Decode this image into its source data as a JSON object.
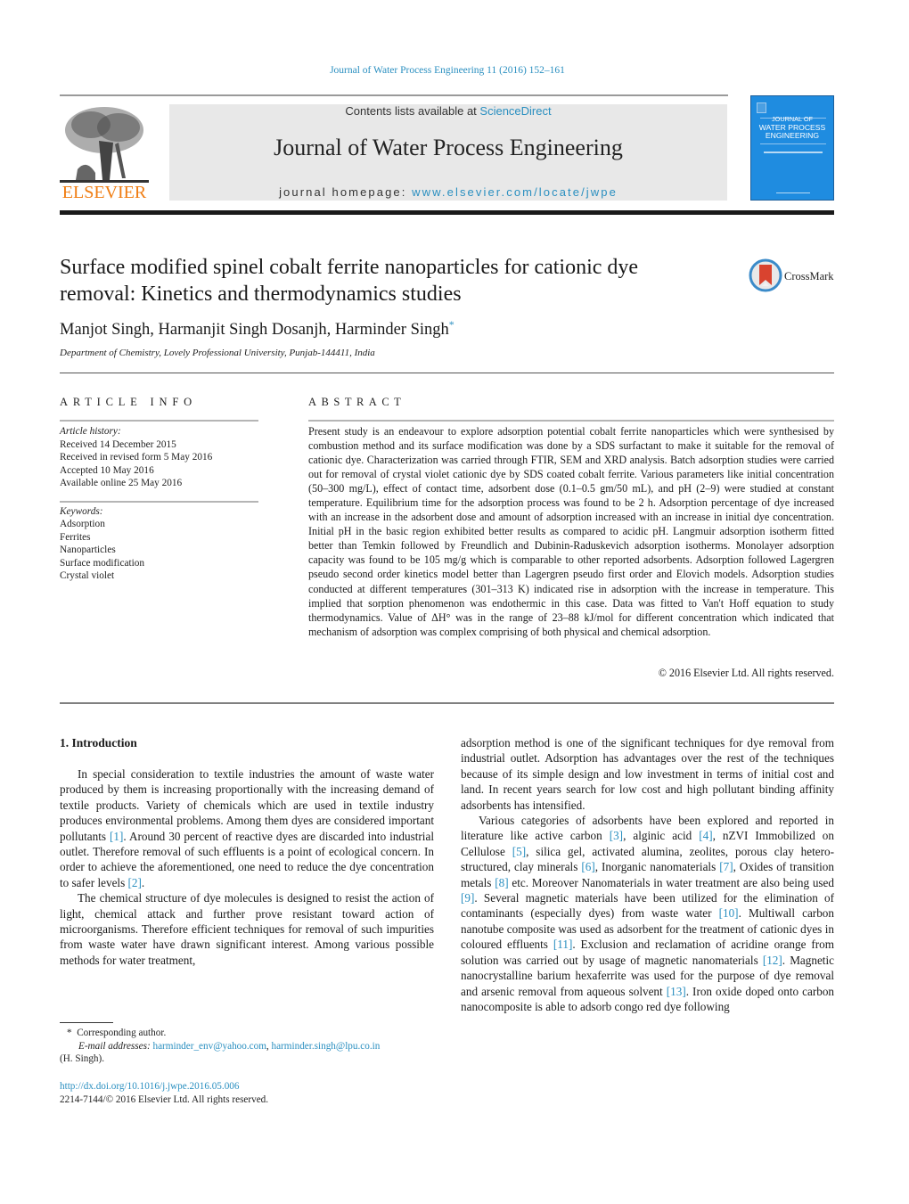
{
  "running_head": "Journal of Water Process Engineering 11 (2016) 152–161",
  "logo": {
    "icon": "elsevier-tree-icon",
    "wordmark": "ELSEVIER",
    "color": "#f07d12"
  },
  "masthead": {
    "contents_prefix": "Contents lists available at ",
    "contents_link": "ScienceDirect",
    "journal_title": "Journal of Water Process Engineering",
    "homepage_prefix": "journal homepage: ",
    "homepage_link": "www.elsevier.com/locate/jwpe"
  },
  "cover": {
    "title_line1": "JOURNAL OF",
    "title_line2": "WATER PROCESS",
    "title_line3": "ENGINEERING",
    "color": "#1f8ce0"
  },
  "article": {
    "title": "Surface modified spinel cobalt ferrite nanoparticles for cationic dye removal: Kinetics and thermodynamics studies",
    "authors": "Manjot Singh, Harmanjit Singh Dosanjh, Harminder Singh",
    "corresponding_mark": "*",
    "affiliation": "Department of Chemistry, Lovely Professional University, Punjab-144411, India"
  },
  "crossmark": {
    "label": "CrossMark",
    "icon": "crossmark-icon"
  },
  "article_info": {
    "heading": "ARTICLE INFO",
    "history_label": "Article history:",
    "history": [
      "Received 14 December 2015",
      "Received in revised form 5 May 2016",
      "Accepted 10 May 2016",
      "Available online 25 May 2016"
    ],
    "keywords_label": "Keywords:",
    "keywords": [
      "Adsorption",
      "Ferrites",
      "Nanoparticles",
      "Surface modification",
      "Crystal violet"
    ]
  },
  "abstract": {
    "heading": "ABSTRACT",
    "text": "Present study is an endeavour to explore adsorption potential cobalt ferrite nanoparticles which were synthesised by combustion method and its surface modification was done by a SDS surfactant to make it suitable for the removal of cationic dye. Characterization was carried through FTIR, SEM and XRD analysis. Batch adsorption studies were carried out for removal of crystal violet cationic dye by SDS coated cobalt ferrite. Various parameters like initial concentration (50–300 mg/L), effect of contact time, adsorbent dose (0.1–0.5 gm/50 mL), and pH (2–9) were studied at constant temperature. Equilibrium time for the adsorption process was found to be 2 h. Adsorption percentage of dye increased with an increase in the adsorbent dose and amount of adsorption increased with an increase in initial dye concentration. Initial pH in the basic region exhibited better results as compared to acidic pH. Langmuir adsorption isotherm fitted better than Temkin followed by Freundlich and Dubinin-Raduskevich adsorption isotherms. Monolayer adsorption capacity was found to be 105 mg/g which is comparable to other reported adsorbents. Adsorption followed Lagergren pseudo second order kinetics model better than Lagergren pseudo first order and Elovich models. Adsorption studies conducted at different temperatures (301–313 K) indicated rise in adsorption with the increase in temperature. This implied that sorption phenomenon was endothermic in this case. Data was fitted to Van't Hoff equation to study thermodynamics. Value of ΔH° was in the range of 23–88 kJ/mol for different concentration which indicated that mechanism of adsorption was complex comprising of both physical and chemical adsorption.",
    "copyright": "© 2016 Elsevier Ltd. All rights reserved."
  },
  "body": {
    "section_heading": "1.  Introduction",
    "left_paragraphs": [
      [
        {
          "t": "In special consideration to textile industries the amount of waste water produced by them is increasing proportionally with the increasing demand of textile products. Variety of chemicals which are used in textile industry produces environmental problems. Among them dyes are considered important pollutants "
        },
        {
          "c": "[1]"
        },
        {
          "t": ". Around 30 percent of reactive dyes are discarded into industrial outlet. Therefore removal of such effluents is a point of ecological concern. In order to achieve the aforementioned, one need to reduce the dye concentration to safer levels "
        },
        {
          "c": "[2]"
        },
        {
          "t": "."
        }
      ],
      [
        {
          "t": "The chemical structure of dye molecules is designed to resist the action of light, chemical attack and further prove resistant toward action of microorganisms. Therefore efficient techniques for removal of such impurities from waste water have drawn significant interest. Among various possible methods for water treatment,"
        }
      ]
    ],
    "right_paragraphs": [
      [
        {
          "t": "adsorption method is one of the significant techniques for dye removal from industrial outlet. Adsorption has advantages over the rest of the techniques because of its simple design and low investment in terms of initial cost and land. In recent years search for low cost and high pollutant binding affinity adsorbents has intensified."
        }
      ],
      [
        {
          "t": "Various categories of adsorbents have been explored and reported in literature like active carbon "
        },
        {
          "c": "[3]"
        },
        {
          "t": ", alginic acid "
        },
        {
          "c": "[4]"
        },
        {
          "t": ", nZVI Immobilized on Cellulose "
        },
        {
          "c": "[5]"
        },
        {
          "t": ", silica gel, activated alumina, zeolites, porous clay hetero-structured, clay minerals "
        },
        {
          "c": "[6]"
        },
        {
          "t": ", Inorganic nanomaterials "
        },
        {
          "c": "[7]"
        },
        {
          "t": ", Oxides of transition metals "
        },
        {
          "c": "[8]"
        },
        {
          "t": " etc. Moreover Nanomaterials in water treatment are also being used "
        },
        {
          "c": "[9]"
        },
        {
          "t": ". Several magnetic materials have been utilized for the elimination of contaminants (especially dyes) from waste water "
        },
        {
          "c": "[10]"
        },
        {
          "t": ". Multiwall carbon nanotube composite was used as adsorbent for the treatment of cationic dyes in coloured effluents "
        },
        {
          "c": "[11]"
        },
        {
          "t": ". Exclusion and reclamation of acridine orange from solution was carried out by usage of magnetic nanomaterials "
        },
        {
          "c": "[12]"
        },
        {
          "t": ". Magnetic nanocrystalline barium hexaferrite was used for the purpose of dye removal and arsenic removal from aqueous solvent "
        },
        {
          "c": "[13]"
        },
        {
          "t": ". Iron oxide doped onto carbon nanocomposite is able to adsorb congo red dye following"
        }
      ]
    ]
  },
  "footnote": {
    "mark": "*",
    "corresponding": "Corresponding author.",
    "email_label": "E-mail addresses:",
    "emails": [
      "harminder_env@yahoo.com",
      "harminder.singh@lpu.co.in"
    ],
    "name": "(H. Singh)."
  },
  "doi": {
    "link": "http://dx.doi.org/10.1016/j.jwpe.2016.05.006",
    "issn_line": "2214-7144/© 2016 Elsevier Ltd. All rights reserved."
  },
  "colors": {
    "link": "#2a8fc0",
    "masthead_bg": "#e8e8e8",
    "elsevier_orange": "#f07d12"
  }
}
